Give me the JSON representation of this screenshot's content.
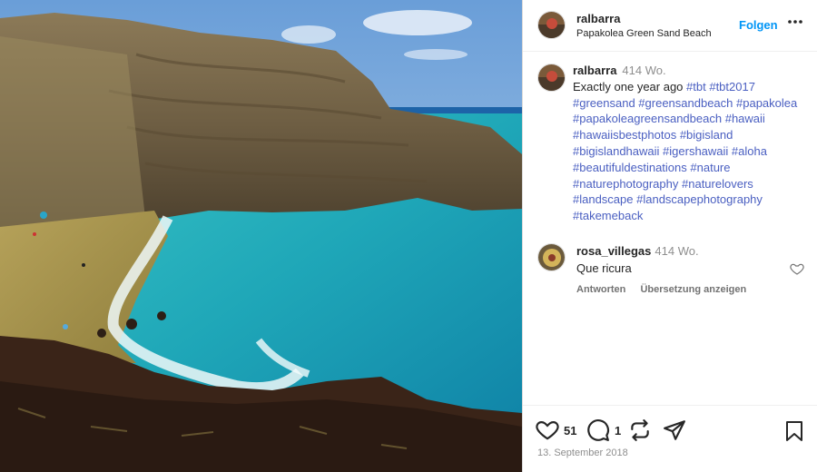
{
  "post": {
    "image_alt": "Papakolea Green Sand Beach",
    "author": "ralbarra",
    "location": "Papakolea Green Sand Beach",
    "follow_label": "Folgen",
    "more_icon": "more-icon"
  },
  "caption": {
    "user": "ralbarra",
    "age": "414 Wo.",
    "text": "Exactly one year ago",
    "tags": [
      "#tbt",
      "#tbt2017",
      "#greensand",
      "#greensandbeach",
      "#papakolea",
      "#papakoleagreensandbeach",
      "#hawaii",
      "#hawaiisbestphotos",
      "#bigisland",
      "#bigislandhawaii",
      "#igershawaii",
      "#aloha",
      "#beautifuldestinations",
      "#nature",
      "#naturephotography",
      "#naturelovers",
      "#landscape",
      "#landscapephotography",
      "#takemeback"
    ]
  },
  "comment": {
    "user": "rosa_villegas",
    "age": "414 Wo.",
    "text": "Que ricura",
    "reply_label": "Antworten",
    "translate_label": "Übersetzung anzeigen"
  },
  "actions": {
    "likes": "51",
    "comments": "1",
    "date": "13. September 2018"
  },
  "colors": {
    "link": "#4a5fc1",
    "follow": "#0095f6",
    "muted": "#8e8e8e"
  }
}
